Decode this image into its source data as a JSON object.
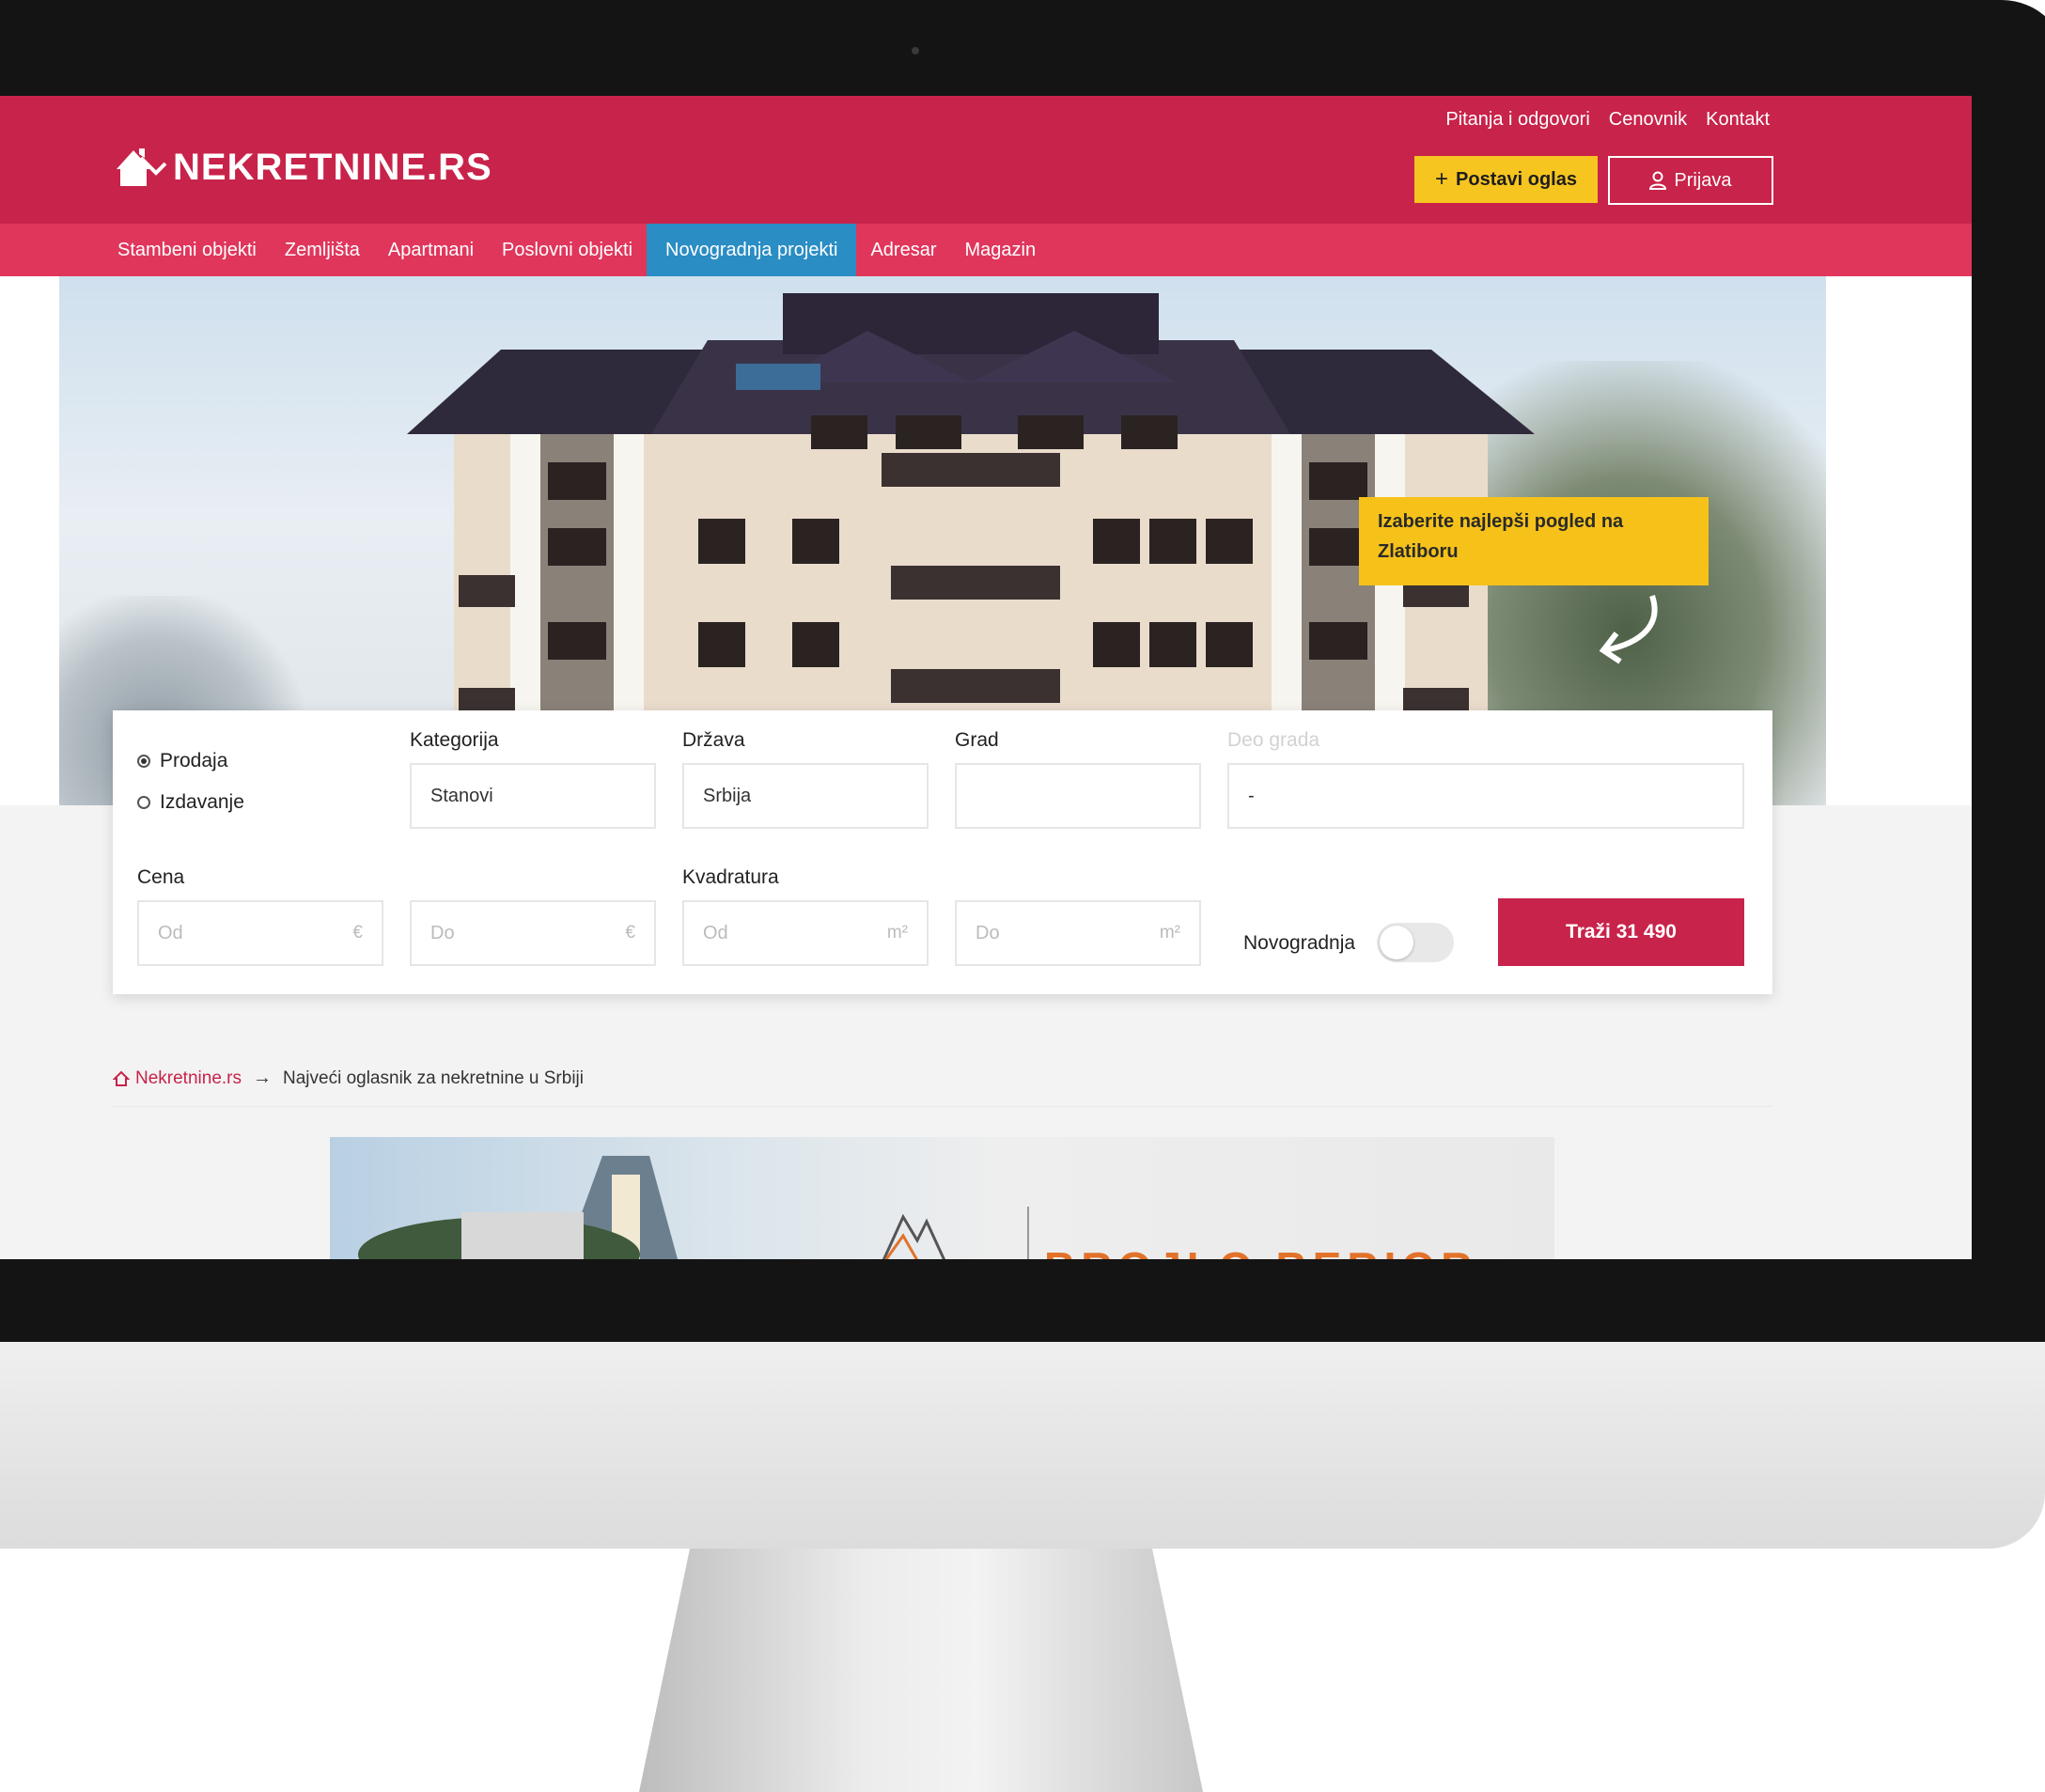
{
  "header": {
    "logo_text": "NEKRETNINE.RS",
    "top_links": [
      "Pitanja i odgovori",
      "Cenovnik",
      "Kontakt"
    ],
    "post_button": "Postavi oglas",
    "login_button": "Prijava"
  },
  "nav": {
    "items": [
      {
        "label": "Stambeni objekti"
      },
      {
        "label": "Zemljišta"
      },
      {
        "label": "Apartmani"
      },
      {
        "label": "Poslovni objekti"
      },
      {
        "label": "Novogradnja projekti",
        "active": true
      },
      {
        "label": "Adresar"
      },
      {
        "label": "Magazin"
      }
    ]
  },
  "hero": {
    "promo_text": "Izaberite najlepši pogled na Zlatiboru"
  },
  "search": {
    "radio_sale": "Prodaja",
    "radio_rent": "Izdavanje",
    "category_label": "Kategorija",
    "category_value": "Stanovi",
    "country_label": "Država",
    "country_value": "Srbija",
    "city_label": "Grad",
    "city_value": "",
    "city_part_label": "Deo grada",
    "city_part_value": "-",
    "price_label": "Cena",
    "price_from_placeholder": "Od",
    "price_to_placeholder": "Do",
    "price_unit": "€",
    "area_label": "Kvadratura",
    "area_from_placeholder": "Od",
    "area_to_placeholder": "Do",
    "area_unit": "m²",
    "new_build_label": "Novogradnja",
    "submit_button": "Traži 31 490"
  },
  "breadcrumb": {
    "home": "Nekretnine.rs",
    "current": "Najveći oglasnik za nekretnine u Srbiji"
  },
  "banner": {
    "text": "BROJLO BERIOR"
  },
  "colors": {
    "brand": "#c8234a",
    "nav": "#e0365c",
    "active_nav": "#2a8dc4",
    "accent": "#f7c51f"
  }
}
